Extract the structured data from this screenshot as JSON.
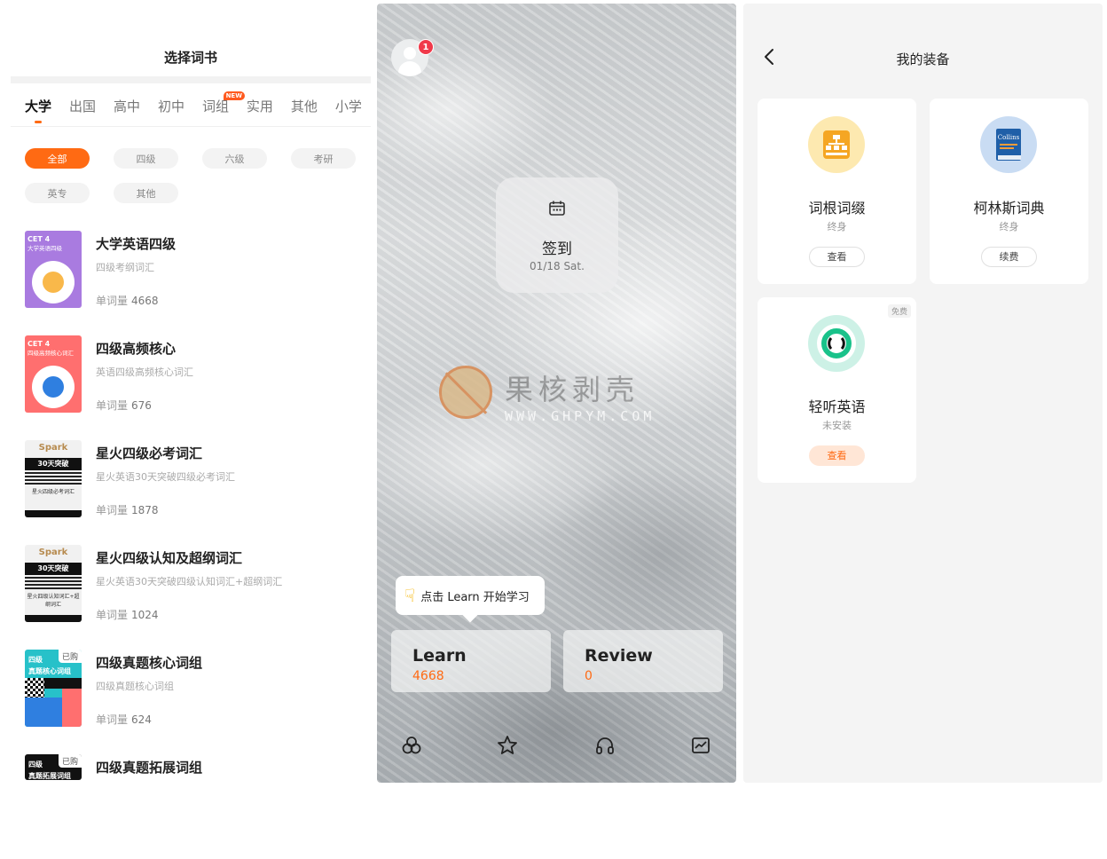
{
  "wordbook": {
    "title": "选择词书",
    "tabs": [
      {
        "label": "大学"
      },
      {
        "label": "出国"
      },
      {
        "label": "高中"
      },
      {
        "label": "初中"
      },
      {
        "label": "词组",
        "badge": "NEW"
      },
      {
        "label": "实用"
      },
      {
        "label": "其他"
      },
      {
        "label": "小学"
      }
    ],
    "filters": [
      "全部",
      "四级",
      "六级",
      "考研",
      "英专",
      "其他"
    ],
    "count_label": "单词量",
    "books": [
      {
        "name": "大学英语四级",
        "desc": "四级考纲词汇",
        "count": "4668",
        "cover_tag": "CET 4",
        "cover_sub": "大学英语四级"
      },
      {
        "name": "四级高频核心",
        "desc": "英语四级高频核心词汇",
        "count": "676",
        "cover_tag": "CET 4",
        "cover_sub": "四级高频核心词汇"
      },
      {
        "name": "星火四级必考词汇",
        "desc": "星火英语30天突破四级必考词汇",
        "count": "1878",
        "cover_tag": "Spark",
        "cover_bar": "30天突破",
        "cover_sub": "星火四级必考词汇"
      },
      {
        "name": "星火四级认知及超纲词汇",
        "desc": "星火英语30天突破四级认知词汇+超纲词汇",
        "count": "1024",
        "cover_tag": "Spark",
        "cover_bar": "30天突破",
        "cover_sub": "星火四级认知词汇+超纲词汇"
      },
      {
        "name": "四级真题核心词组",
        "desc": "四级真题核心词组",
        "count": "624",
        "cover_tag": "四级",
        "cover_sub": "真题核心词组",
        "bought": "已购"
      },
      {
        "name": "四级真题拓展词组",
        "cover_tag": "四级",
        "cover_sub": "真题拓展词组",
        "bought": "已购"
      }
    ]
  },
  "home": {
    "notification_count": "1",
    "signin": {
      "label": "签到",
      "date": "01/18 Sat."
    },
    "watermark": {
      "text": "果核剥壳",
      "url": "WWW.GHPYM.COM"
    },
    "tooltip": "点击 Learn 开始学习",
    "learn": {
      "label": "Learn",
      "count": "4668"
    },
    "review": {
      "label": "Review",
      "count": "0"
    },
    "nav_icons": [
      "apps-icon",
      "star-icon",
      "headphones-icon",
      "chart-icon"
    ]
  },
  "equipment": {
    "title": "我的装备",
    "tools": [
      {
        "name": "词根词缀",
        "status": "终身",
        "button": "查看"
      },
      {
        "name": "柯林斯词典",
        "status": "终身",
        "button": "续费",
        "icon_text": "Collins"
      },
      {
        "name": "轻听英语",
        "status": "未安装",
        "button": "查看",
        "tag": "免费"
      }
    ]
  },
  "colors": {
    "accent": "#ff6a13",
    "badge_red": "#f0394a"
  }
}
